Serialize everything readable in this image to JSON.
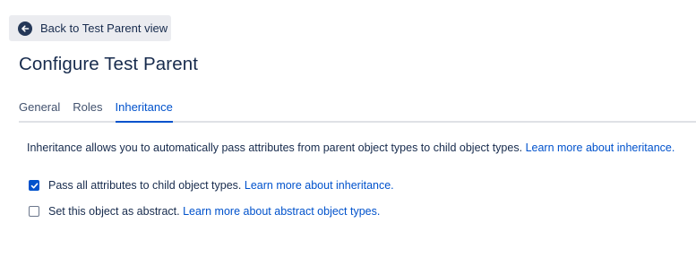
{
  "back_button": {
    "label": "Back to Test Parent view",
    "icon": "arrow-left-circle-icon"
  },
  "page_title": "Configure Test Parent",
  "tabs": [
    {
      "label": "General",
      "active": false
    },
    {
      "label": "Roles",
      "active": false
    },
    {
      "label": "Inheritance",
      "active": true
    }
  ],
  "inheritance": {
    "description": "Inheritance allows you to automatically pass attributes from parent object types to child object types.",
    "description_link": "Learn more about inheritance.",
    "options": [
      {
        "label": "Pass all attributes to child object types.",
        "link": "Learn more about inheritance.",
        "checked": true
      },
      {
        "label": "Set this object as abstract.",
        "link": "Learn more about abstract object types.",
        "checked": false
      }
    ]
  },
  "colors": {
    "accent": "#0052cc",
    "text": "#172b4d",
    "button_bg": "#ebecf0",
    "tab_border": "#dfe1e6"
  }
}
